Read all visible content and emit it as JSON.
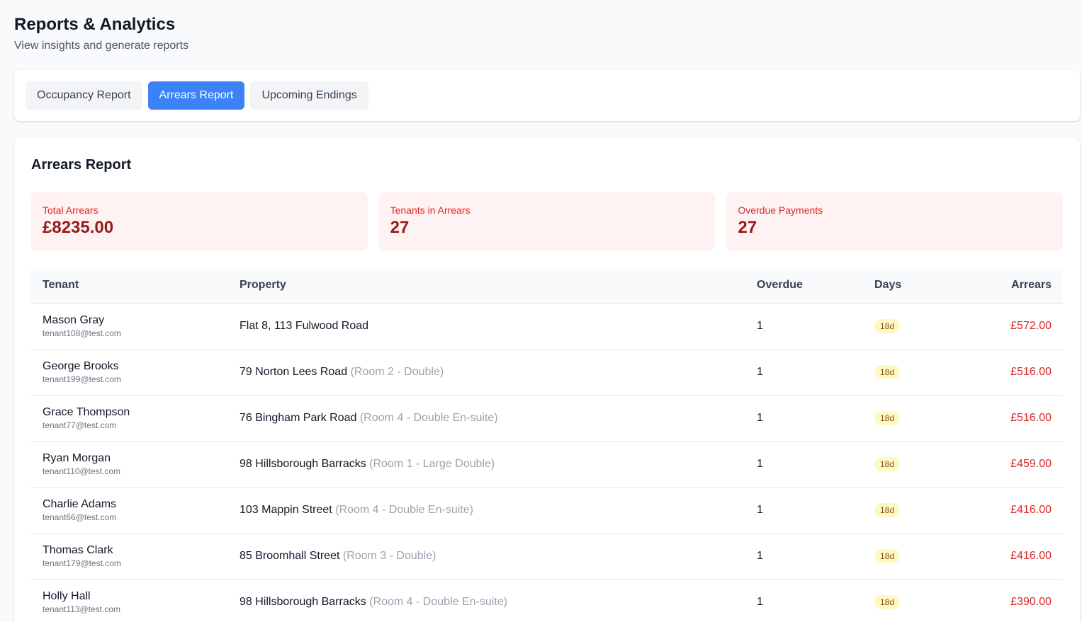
{
  "header": {
    "title": "Reports & Analytics",
    "subtitle": "View insights and generate reports"
  },
  "tabs": [
    {
      "label": "Occupancy Report",
      "active": false
    },
    {
      "label": "Arrears Report",
      "active": true
    },
    {
      "label": "Upcoming Endings",
      "active": false
    }
  ],
  "report": {
    "title": "Arrears Report",
    "stats": [
      {
        "label": "Total Arrears",
        "value": "£8235.00"
      },
      {
        "label": "Tenants in Arrears",
        "value": "27"
      },
      {
        "label": "Overdue Payments",
        "value": "27"
      }
    ],
    "columns": [
      "Tenant",
      "Property",
      "Overdue",
      "Days",
      "Arrears"
    ],
    "rows": [
      {
        "name": "Mason Gray",
        "email": "tenant108@test.com",
        "property": "Flat 8, 113 Fulwood Road",
        "room": "",
        "overdue": "1",
        "days": "18d",
        "arrears": "£572.00"
      },
      {
        "name": "George Brooks",
        "email": "tenant199@test.com",
        "property": "79 Norton Lees Road",
        "room": "(Room 2 - Double)",
        "overdue": "1",
        "days": "18d",
        "arrears": "£516.00"
      },
      {
        "name": "Grace Thompson",
        "email": "tenant77@test.com",
        "property": "76 Bingham Park Road",
        "room": "(Room 4 - Double En-suite)",
        "overdue": "1",
        "days": "18d",
        "arrears": "£516.00"
      },
      {
        "name": "Ryan Morgan",
        "email": "tenant110@test.com",
        "property": "98 Hillsborough Barracks",
        "room": "(Room 1 - Large Double)",
        "overdue": "1",
        "days": "18d",
        "arrears": "£459.00"
      },
      {
        "name": "Charlie Adams",
        "email": "tenant66@test.com",
        "property": "103 Mappin Street",
        "room": "(Room 4 - Double En-suite)",
        "overdue": "1",
        "days": "18d",
        "arrears": "£416.00"
      },
      {
        "name": "Thomas Clark",
        "email": "tenant179@test.com",
        "property": "85 Broomhall Street",
        "room": "(Room 3 - Double)",
        "overdue": "1",
        "days": "18d",
        "arrears": "£416.00"
      },
      {
        "name": "Holly Hall",
        "email": "tenant113@test.com",
        "property": "98 Hillsborough Barracks",
        "room": "(Room 4 - Double En-suite)",
        "overdue": "1",
        "days": "18d",
        "arrears": "£390.00"
      }
    ]
  }
}
